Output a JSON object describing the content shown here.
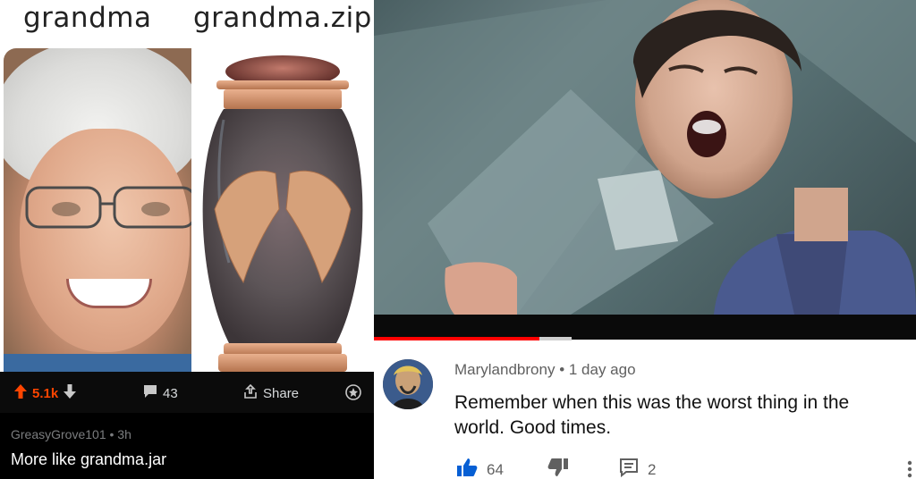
{
  "left_panel": {
    "captions": {
      "left": "grandma",
      "right": "grandma.zip"
    },
    "reddit": {
      "votes": "5.1k",
      "comments": "43",
      "share_label": "Share",
      "comment_author": "GreasyGrove101",
      "comment_time": "3h",
      "comment_text": "More like grandma.jar"
    }
  },
  "right_panel": {
    "video_progress": 0.51,
    "comment": {
      "author": "Marylandbrony",
      "time": "1 day ago",
      "text": "Remember when this was the worst thing in the world. Good times.",
      "likes": "64",
      "replies": "2"
    }
  },
  "colors": {
    "reddit_orange": "#ff4500",
    "yt_blue": "#065fd4",
    "yt_red": "#ff0000"
  }
}
